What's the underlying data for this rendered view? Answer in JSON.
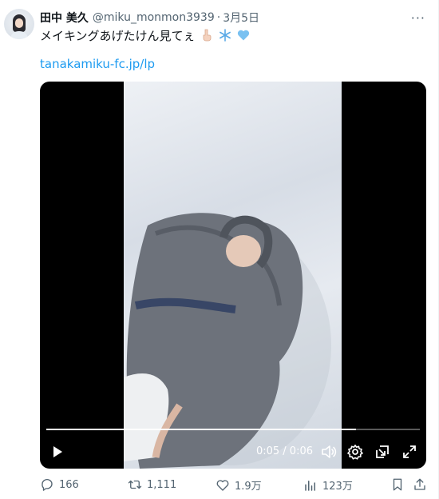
{
  "tweet": {
    "author_name": "田中 美久",
    "handle": "@miku_monmon3939",
    "separator": "·",
    "date": "3月5日",
    "text": "メイキングあげたけん見てぇ",
    "emojis": [
      "pointing-hand",
      "snowflake",
      "blue-heart"
    ],
    "link": "tanakamiku-fc.jp/lp",
    "more_label": "···"
  },
  "video": {
    "time_display": "0:05 / 0:06",
    "progress": 0.83
  },
  "actions": {
    "replies": "166",
    "retweets": "1,111",
    "likes": "1.9万",
    "views": "123万"
  },
  "colors": {
    "link": "#1d9bf0",
    "secondary_text": "#536471",
    "video_bg": "#000000"
  }
}
